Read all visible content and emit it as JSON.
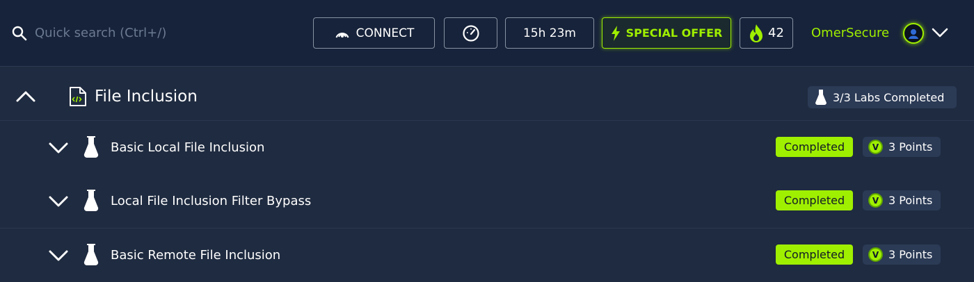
{
  "topbar": {
    "search_placeholder": "Quick search (Ctrl+/)",
    "connect_label": "CONNECT",
    "timer_label": "15h 23m",
    "offer_label": "SPECIAL OFFER",
    "streak_count": "42",
    "user_name": "OmerSecure"
  },
  "section": {
    "title": "File Inclusion",
    "labs_completed": "3/3 Labs Completed"
  },
  "labs": [
    {
      "title": "Basic Local File Inclusion",
      "status": "Completed",
      "points": "3 Points",
      "coin": "V"
    },
    {
      "title": "Local File Inclusion Filter Bypass",
      "status": "Completed",
      "points": "3 Points",
      "coin": "V"
    },
    {
      "title": "Basic Remote File Inclusion",
      "status": "Completed",
      "points": "3 Points",
      "coin": "V"
    }
  ],
  "colors": {
    "accent_green": "#9fef00",
    "background": "#1f2b40",
    "topbar": "#17233a",
    "badge_bg": "#2b3a55"
  },
  "icons": {
    "search": "search-icon",
    "connect": "wifi-signal-icon",
    "speed": "speedometer-icon",
    "offer": "lightning-bolt-icon",
    "streak": "flame-icon",
    "collapse": "chevron-up-icon",
    "expand": "chevron-down-icon",
    "file": "file-code-icon",
    "lab": "flask-icon"
  }
}
